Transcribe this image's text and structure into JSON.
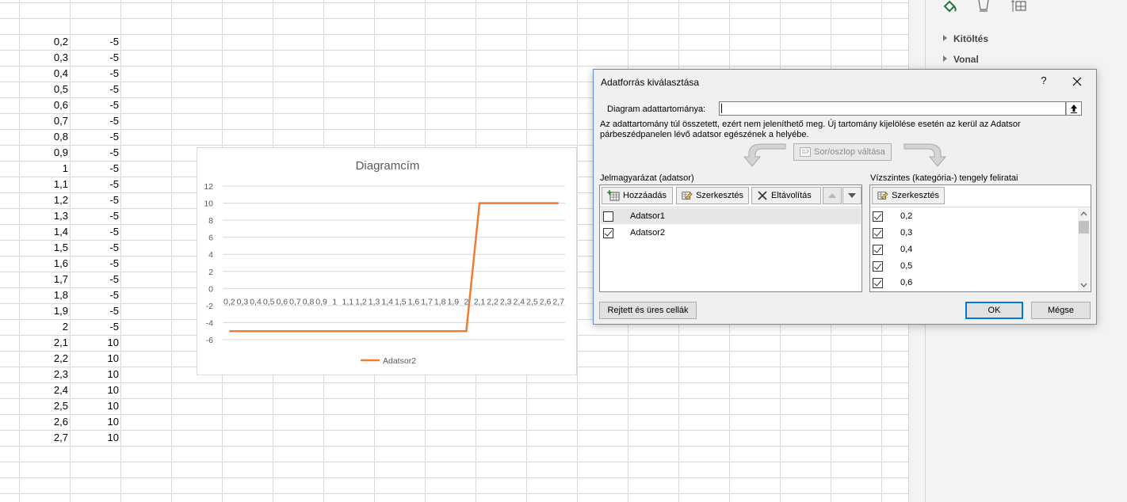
{
  "sheet": {
    "rows": [
      {
        "a": "0,2",
        "b": "-5"
      },
      {
        "a": "0,3",
        "b": "-5"
      },
      {
        "a": "0,4",
        "b": "-5"
      },
      {
        "a": "0,5",
        "b": "-5"
      },
      {
        "a": "0,6",
        "b": "-5"
      },
      {
        "a": "0,7",
        "b": "-5"
      },
      {
        "a": "0,8",
        "b": "-5"
      },
      {
        "a": "0,9",
        "b": "-5"
      },
      {
        "a": "1",
        "b": "-5"
      },
      {
        "a": "1,1",
        "b": "-5"
      },
      {
        "a": "1,2",
        "b": "-5"
      },
      {
        "a": "1,3",
        "b": "-5"
      },
      {
        "a": "1,4",
        "b": "-5"
      },
      {
        "a": "1,5",
        "b": "-5"
      },
      {
        "a": "1,6",
        "b": "-5"
      },
      {
        "a": "1,7",
        "b": "-5"
      },
      {
        "a": "1,8",
        "b": "-5"
      },
      {
        "a": "1,9",
        "b": "-5"
      },
      {
        "a": "2",
        "b": "-5"
      },
      {
        "a": "2,1",
        "b": "10"
      },
      {
        "a": "2,2",
        "b": "10"
      },
      {
        "a": "2,3",
        "b": "10"
      },
      {
        "a": "2,4",
        "b": "10"
      },
      {
        "a": "2,5",
        "b": "10"
      },
      {
        "a": "2,6",
        "b": "10"
      },
      {
        "a": "2,7",
        "b": "10"
      }
    ]
  },
  "pane": {
    "sections": [
      {
        "label": "Kitöltés"
      },
      {
        "label": "Vonal"
      }
    ],
    "tab_icons": [
      "fill-line-icon",
      "effects-icon",
      "size-properties-icon"
    ],
    "accent": "#217346"
  },
  "chart_data": {
    "type": "line",
    "title": "Diagramcím",
    "categories": [
      "0,2",
      "0,3",
      "0,4",
      "0,5",
      "0,6",
      "0,7",
      "0,8",
      "0,9",
      "1",
      "1,1",
      "1,2",
      "1,3",
      "1,4",
      "1,5",
      "1,6",
      "1,7",
      "1,8",
      "1,9",
      "2",
      "2,1",
      "2,2",
      "2,3",
      "2,4",
      "2,5",
      "2,6",
      "2,7"
    ],
    "series": [
      {
        "name": "Adatsor2",
        "color": "#ed7d31",
        "values": [
          -5,
          -5,
          -5,
          -5,
          -5,
          -5,
          -5,
          -5,
          -5,
          -5,
          -5,
          -5,
          -5,
          -5,
          -5,
          -5,
          -5,
          -5,
          -5,
          10,
          10,
          10,
          10,
          10,
          10,
          10
        ]
      }
    ],
    "yticks": [
      "12",
      "10",
      "8",
      "6",
      "4",
      "2",
      "0",
      "-2",
      "-4",
      "-6"
    ],
    "ylim": [
      -6,
      12
    ],
    "grid": true,
    "legend": "bottom",
    "xlabel": "",
    "ylabel": ""
  },
  "dialog": {
    "title": "Adatforrás kiválasztása",
    "help": "?",
    "range_label": "Diagram adattartománya:",
    "range_value": "",
    "message_line1": "Az adattartomány túl összetett, ezért nem jeleníthető meg. Új tartomány kijelölése esetén az kerül az Adatsor",
    "message_line2": "párbeszédpanelen lévő adatsor egészének a helyébe.",
    "switch_label": "Sor/oszlop váltása",
    "legend_header": "Jelmagyarázat (adatsor)",
    "axis_header": "Vízszintes (kategória-) tengely feliratai",
    "add_label": "Hozzáadás",
    "edit_label": "Szerkesztés",
    "remove_label": "Eltávolítás",
    "axis_edit_label": "Szerkesztés",
    "series": [
      {
        "label": "Adatsor1",
        "checked": false
      },
      {
        "label": "Adatsor2",
        "checked": true
      }
    ],
    "axis_items": [
      {
        "label": "0,2",
        "checked": true
      },
      {
        "label": "0,3",
        "checked": true
      },
      {
        "label": "0,4",
        "checked": true
      },
      {
        "label": "0,5",
        "checked": true
      },
      {
        "label": "0,6",
        "checked": true
      }
    ],
    "hidden_cells_label": "Rejtett és üres cellák",
    "ok_label": "OK",
    "cancel_label": "Mégse"
  }
}
